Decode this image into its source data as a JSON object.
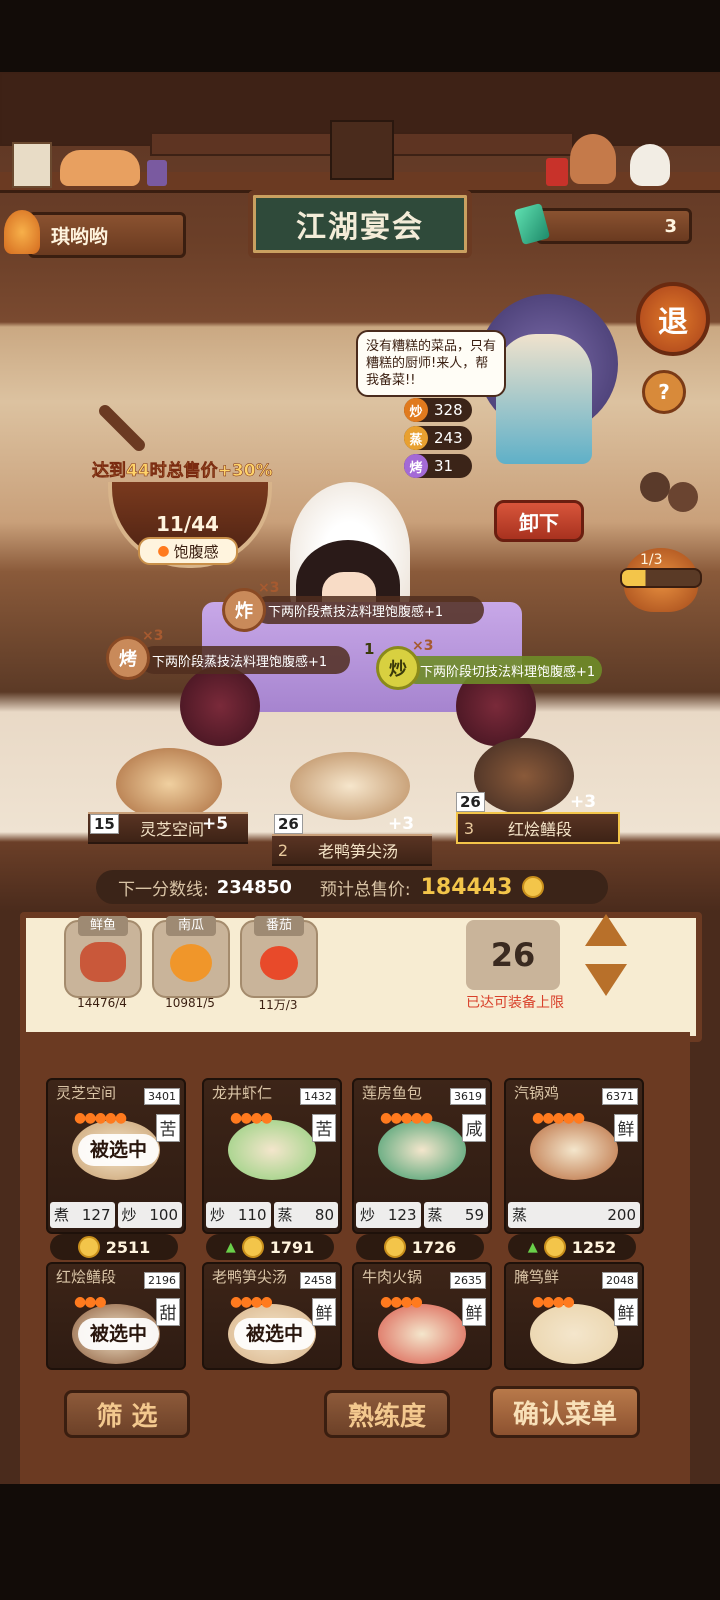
{
  "player": {
    "name": "琪哟哟"
  },
  "hud": {
    "gem_count": "3",
    "exit_label": "退",
    "help_label": "?"
  },
  "sign": {
    "title": "江湖宴会"
  },
  "npc": {
    "speech": "没有糟糕的菜品，只有糟糕的厨师!来人，帮我备菜!!",
    "stats": [
      {
        "skill": "炒",
        "value": "328",
        "color": "#e07a1e"
      },
      {
        "skill": "蒸",
        "value": "243",
        "color": "#e8a030"
      },
      {
        "skill": "烤",
        "value": "31",
        "color": "#a46ad6"
      }
    ],
    "unload_label": "卸下",
    "page": "1/3"
  },
  "satiety": {
    "bonus_text": "达到44时总售价+30%",
    "progress": "11/44",
    "label": "饱腹感",
    "value": 11,
    "target": 44
  },
  "bonuses": [
    {
      "icon": "炸",
      "count": "×3",
      "text": "下两阶段煮技法料理饱腹感+1",
      "level": ""
    },
    {
      "icon": "烤",
      "count": "×3",
      "text": "下两阶段蒸技法料理饱腹感+1",
      "level": ""
    },
    {
      "icon": "炒",
      "count": "×3",
      "text": "下两阶段切技法料理饱腹感+1",
      "level": "1"
    }
  ],
  "stage_dishes": [
    {
      "index": "1",
      "name": "灵芝空间",
      "badge": "15",
      "bonus": "+5"
    },
    {
      "index": "2",
      "name": "老鸭笋尖汤",
      "badge": "26",
      "bonus": "+3"
    },
    {
      "index": "3",
      "name": "红烩鳝段",
      "badge": "26",
      "bonus": "+3"
    }
  ],
  "score_bar": {
    "next_label": "下一分数线:",
    "next_value": "234850",
    "total_label": "预计总售价:",
    "total_value": "184443"
  },
  "ingredients": [
    {
      "name": "鲜鱼",
      "amount": "14476/4",
      "color": "#c9583a"
    },
    {
      "name": "南瓜",
      "amount": "10981/5",
      "color": "#f0962a"
    },
    {
      "name": "番茄",
      "amount": "11万/3",
      "color": "#e84a2a"
    }
  ],
  "equip": {
    "count": "26",
    "status": "已达可装备上限"
  },
  "recipes": [
    {
      "name": "灵芝空间",
      "score": "3401",
      "flavor": "苦",
      "fires": 5,
      "selected": true,
      "tech": [
        {
          "k": "煮",
          "v": "127"
        },
        {
          "k": "炒",
          "v": "100"
        }
      ],
      "price": "2511",
      "up": false,
      "color": "#c9a070"
    },
    {
      "name": "龙井虾仁",
      "score": "1432",
      "flavor": "苦",
      "fires": 4,
      "selected": false,
      "tech": [
        {
          "k": "炒",
          "v": "110"
        },
        {
          "k": "蒸",
          "v": "80"
        }
      ],
      "price": "1791",
      "up": true,
      "color": "#8fcf7a"
    },
    {
      "name": "莲房鱼包",
      "score": "3619",
      "flavor": "咸",
      "fires": 5,
      "selected": false,
      "tech": [
        {
          "k": "炒",
          "v": "123"
        },
        {
          "k": "蒸",
          "v": "59"
        }
      ],
      "price": "1726",
      "up": false,
      "color": "#3a9a6a"
    },
    {
      "name": "汽锅鸡",
      "score": "6371",
      "flavor": "鲜",
      "fires": 5,
      "selected": false,
      "tech": [
        {
          "k": "蒸",
          "v": "200"
        }
      ],
      "price": "1252",
      "up": true,
      "color": "#b8693a"
    },
    {
      "name": "红烩鳝段",
      "score": "2196",
      "flavor": "甜",
      "fires": 3,
      "selected": true,
      "tech": [],
      "price": "",
      "up": false,
      "color": "#8a5a3a"
    },
    {
      "name": "老鸭笋尖汤",
      "score": "2458",
      "flavor": "鲜",
      "fires": 4,
      "selected": true,
      "tech": [],
      "price": "",
      "up": false,
      "color": "#d9b48a"
    },
    {
      "name": "牛肉火锅",
      "score": "2635",
      "flavor": "鲜",
      "fires": 4,
      "selected": false,
      "tech": [],
      "price": "",
      "up": false,
      "color": "#d9584a"
    },
    {
      "name": "腌笃鲜",
      "score": "2048",
      "flavor": "鲜",
      "fires": 4,
      "selected": false,
      "tech": [],
      "price": "",
      "up": false,
      "color": "#e9d2a8"
    }
  ],
  "selected_label": "被选中",
  "buttons": {
    "filter": "筛 选",
    "mastery": "熟练度",
    "confirm": "确认菜单"
  }
}
